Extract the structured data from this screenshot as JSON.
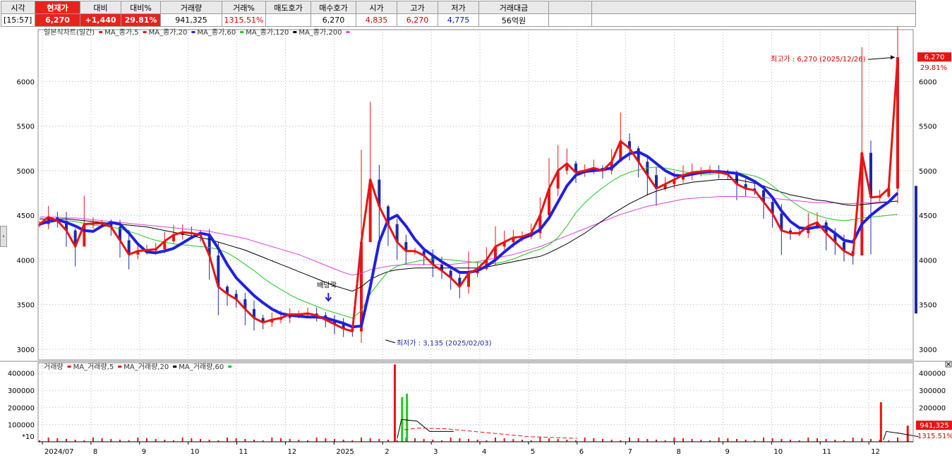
{
  "quote_bar": {
    "headers": [
      "시각",
      "현재가",
      "대비",
      "대비%",
      "거래량",
      "거래%",
      "매도호가",
      "매수호가",
      "시가",
      "고가",
      "저가",
      "거래대금"
    ],
    "values": [
      "[15:57]",
      "6,270",
      "+1,440",
      "29.81%",
      "941,325",
      "1315.51%",
      "",
      "6,270",
      "4,835",
      "6,270",
      "4,775",
      "56억원"
    ]
  },
  "colors": {
    "price": "#e81414",
    "ma5": "#e81414",
    "ma20": "#2020e0",
    "ma60": "#1ec81e",
    "ma120": "#000000",
    "ma200": "#e040e0",
    "down": "#1a2aa8",
    "volume_up": "#e81414",
    "volume_ma20": "#000000",
    "volume_ma60": "#1ec81e"
  },
  "price_legend": {
    "title": "일본식차트(일간)",
    "items": [
      "MA_종가,5",
      "MA_종가,20",
      "MA_종가,60",
      "MA_종가,120",
      "MA_종가,200"
    ]
  },
  "volume_legend": {
    "title": "거래량",
    "items": [
      "MA_거래량,5",
      "MA_거래량,20",
      "MA_거래량,60"
    ]
  },
  "chart_data": [
    {
      "type": "line",
      "subtype": "candlestick-with-moving-averages",
      "title": "일본식차트(일간)",
      "ylim": [
        2880,
        6580
      ],
      "y_ticks": [
        3000,
        3500,
        4000,
        4500,
        5000,
        5500,
        6000
      ],
      "x_tick_labels": [
        "2024/07",
        "8",
        "9",
        "10",
        "11",
        "12",
        "2025",
        "2",
        "3",
        "4",
        "5",
        "6",
        "7",
        "8",
        "9",
        "10",
        "11",
        "12"
      ],
      "grid": true,
      "legend_placement": "top-left",
      "series": [
        {
          "name": "MA_종가,5",
          "values": [
            4400,
            4480,
            4440,
            4330,
            4150,
            4400,
            4410,
            4410,
            4370,
            4220,
            4060,
            4100,
            4110,
            4120,
            4210,
            4280,
            4310,
            4300,
            4280,
            4050,
            3700,
            3620,
            3560,
            3450,
            3350,
            3300,
            3330,
            3350,
            3390,
            3390,
            3400,
            3380,
            3330,
            3280,
            3230,
            3200,
            4200,
            4900,
            4600,
            4400,
            4200,
            4100,
            4100,
            4050,
            3950,
            3880,
            3800,
            3700,
            3850,
            3900,
            4000,
            4150,
            4200,
            4250,
            4260,
            4300,
            4500,
            4800,
            5000,
            5080,
            4980,
            5000,
            5030,
            5000,
            5100,
            5330,
            5250,
            5100,
            4950,
            4800,
            4850,
            4900,
            4950,
            4980,
            4990,
            5000,
            4980,
            4960,
            4850,
            4800,
            4780,
            4650,
            4520,
            4330,
            4300,
            4300,
            4380,
            4420,
            4300,
            4200,
            4100,
            4050,
            5200,
            4700,
            4710,
            4800,
            6270
          ]
        },
        {
          "name": "MA_종가,20",
          "values": [
            4400,
            4430,
            4450,
            4420,
            4380,
            4330,
            4320,
            4380,
            4420,
            4400,
            4300,
            4180,
            4090,
            4080,
            4100,
            4130,
            4190,
            4250,
            4300,
            4280,
            4130,
            3950,
            3800,
            3700,
            3600,
            3520,
            3450,
            3400,
            3380,
            3370,
            3360,
            3360,
            3350,
            3320,
            3290,
            3250,
            3260,
            3700,
            4200,
            4450,
            4500,
            4380,
            4230,
            4120,
            4050,
            3980,
            3920,
            3860,
            3860,
            3880,
            3930,
            4000,
            4090,
            4170,
            4240,
            4280,
            4340,
            4470,
            4650,
            4830,
            4950,
            4990,
            5000,
            5010,
            5030,
            5120,
            5190,
            5210,
            5160,
            5080,
            5000,
            4950,
            4940,
            4960,
            4980,
            4990,
            4990,
            4980,
            4970,
            4930,
            4880,
            4810,
            4700,
            4550,
            4430,
            4360,
            4350,
            4370,
            4370,
            4300,
            4220,
            4200,
            4400,
            4500,
            4580,
            4650,
            4750
          ]
        },
        {
          "name": "MA_종가,60",
          "values": [
            4400,
            4420,
            4430,
            4440,
            4430,
            4410,
            4390,
            4380,
            4370,
            4350,
            4320,
            4290,
            4250,
            4220,
            4200,
            4180,
            4170,
            4160,
            4150,
            4140,
            4120,
            4080,
            4020,
            3950,
            3880,
            3800,
            3730,
            3670,
            3610,
            3560,
            3520,
            3480,
            3440,
            3410,
            3380,
            3350,
            3430,
            3620,
            3750,
            3870,
            3930,
            3960,
            3980,
            4000,
            4010,
            4010,
            4000,
            3990,
            3980,
            3970,
            3960,
            3960,
            3980,
            4010,
            4050,
            4090,
            4120,
            4170,
            4250,
            4380,
            4530,
            4640,
            4730,
            4810,
            4880,
            4940,
            4980,
            5010,
            5030,
            5040,
            5030,
            5010,
            4990,
            4970,
            4960,
            4960,
            4970,
            4980,
            4980,
            4960,
            4940,
            4900,
            4830,
            4750,
            4670,
            4600,
            4540,
            4500,
            4470,
            4450,
            4440,
            4450,
            4470,
            4480,
            4490,
            4500,
            4510
          ]
        },
        {
          "name": "MA_종가,120",
          "values": [
            4460,
            4460,
            4460,
            4460,
            4450,
            4440,
            4430,
            4420,
            4410,
            4400,
            4390,
            4380,
            4370,
            4350,
            4330,
            4310,
            4290,
            4270,
            4250,
            4230,
            4200,
            4170,
            4140,
            4110,
            4070,
            4030,
            3990,
            3950,
            3910,
            3870,
            3830,
            3790,
            3750,
            3710,
            3680,
            3650,
            3700,
            3780,
            3830,
            3870,
            3890,
            3900,
            3910,
            3910,
            3910,
            3910,
            3910,
            3910,
            3910,
            3910,
            3920,
            3940,
            3960,
            3980,
            4000,
            4020,
            4040,
            4080,
            4130,
            4180,
            4240,
            4300,
            4370,
            4440,
            4510,
            4570,
            4630,
            4680,
            4730,
            4770,
            4800,
            4830,
            4850,
            4870,
            4880,
            4890,
            4900,
            4900,
            4900,
            4880,
            4860,
            4830,
            4790,
            4760,
            4730,
            4710,
            4690,
            4670,
            4660,
            4640,
            4620,
            4610,
            4620,
            4630,
            4640,
            4650,
            4660
          ]
        },
        {
          "name": "MA_종가,200",
          "values": [
            4480,
            4480,
            4480,
            4470,
            4470,
            4460,
            4450,
            4440,
            4430,
            4420,
            4410,
            4400,
            4390,
            4380,
            4370,
            4360,
            4350,
            4340,
            4330,
            4320,
            4300,
            4280,
            4260,
            4240,
            4210,
            4180,
            4150,
            4120,
            4090,
            4060,
            4020,
            3980,
            3940,
            3900,
            3860,
            3830,
            3850,
            3890,
            3910,
            3930,
            3940,
            3950,
            3950,
            3950,
            3950,
            3950,
            3950,
            3960,
            3970,
            3980,
            4000,
            4020,
            4040,
            4060,
            4090,
            4120,
            4150,
            4190,
            4230,
            4270,
            4310,
            4350,
            4390,
            4430,
            4470,
            4510,
            4540,
            4570,
            4600,
            4620,
            4640,
            4660,
            4680,
            4690,
            4700,
            4700,
            4710,
            4710,
            4710,
            4710,
            4700,
            4700,
            4690,
            4680,
            4670,
            4660,
            4650,
            4640,
            4640,
            4640,
            4630,
            4630,
            4640,
            4640,
            4650,
            4650,
            4660
          ]
        }
      ],
      "annotations": [
        {
          "text": "최고가 : 6,270 (2025/12/26)"
        },
        {
          "text": "최저가 : 3,135 (2025/02/03)"
        },
        {
          "text": "배당락"
        }
      ],
      "last_price_label": "6,270",
      "last_change_label": "29.81%"
    },
    {
      "type": "bar",
      "title": "거래량",
      "ylim": [
        0,
        460000
      ],
      "y_ticks": [
        100000,
        200000,
        300000,
        400000
      ],
      "scale_note": "*10",
      "spikes": [
        {
          "month_index": 7.25,
          "value": 450000,
          "color": "volume_up"
        },
        {
          "month_index": 7.4,
          "value": 260000,
          "color": "volume_ma60"
        },
        {
          "month_index": 7.5,
          "value": 280000,
          "color": "volume_ma60"
        },
        {
          "month_index": 17.25,
          "value": 230000,
          "color": "volume_up"
        },
        {
          "month_index": 17.8,
          "value": 94132,
          "color": "volume_up"
        }
      ],
      "last_volume_label": "941,325",
      "last_volume_pct_label": "1315.51%"
    }
  ]
}
